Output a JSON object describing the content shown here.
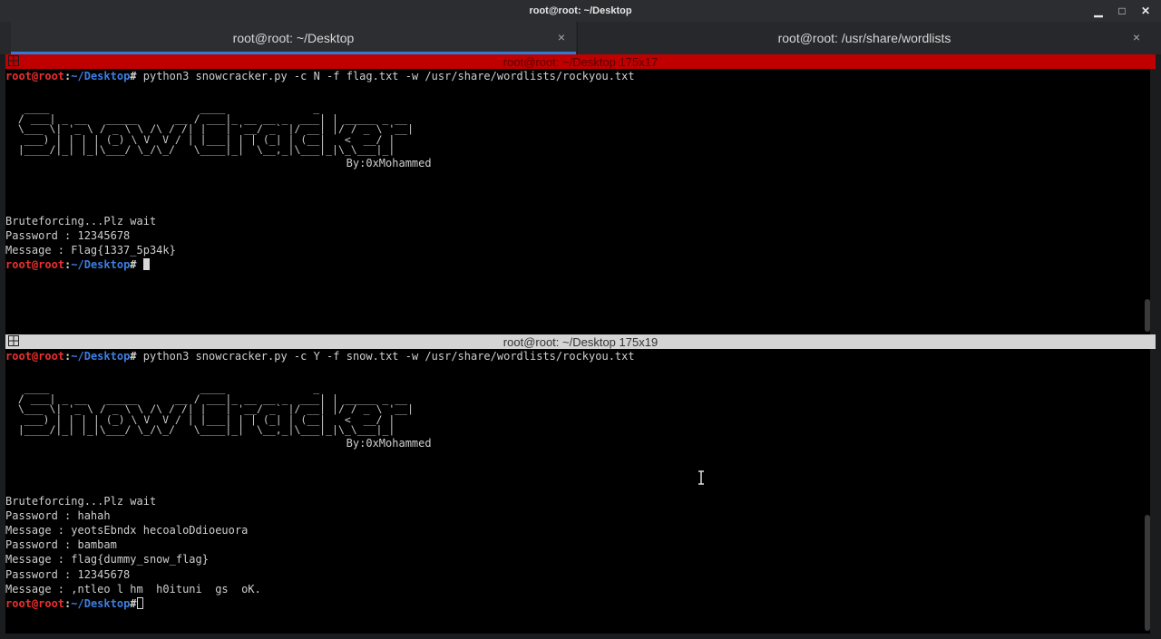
{
  "window": {
    "title": "root@root: ~/Desktop"
  },
  "window_controls": {
    "minimize": "▁",
    "maximize": "□",
    "close": "✕"
  },
  "tabs": [
    {
      "label": "root@root: ~/Desktop",
      "close": "×",
      "active": true
    },
    {
      "label": "root@root: /usr/share/wordlists",
      "close": "×",
      "active": false
    }
  ],
  "colors": {
    "accent": "#2f7bd8",
    "active_pane_header": "#c00000",
    "prompt_user": "#ee2f2f",
    "prompt_path": "#3d7fe0"
  },
  "prompt": {
    "user": "root@root",
    "sep": ":",
    "path": "~/Desktop",
    "symbol": "#"
  },
  "pane_top": {
    "header": "root@root: ~/Desktop 175x17",
    "command": " python3 snowcracker.py -c N -f flag.txt -w /usr/share/wordlists/rockyou.txt",
    "banner": "   ____                        ____              _\n  / ___| _ __   _____      __ / ___|_ __ __ _  ___| | _____ _ __\n  \\___ \\| '_ \\ / _ \\ \\ /\\ / /| |   | '__/ _` |/ __| |/ / _ \\ '__|\n   ___) | | | | (_) \\ V  V / | |___| | | (_| | (__|   <  __/ |\n  |____/|_| |_|\\___/ \\_/\\_/   \\____|_|  \\__,_|\\___|_|\\_\\___|_|",
    "author": "                                                    By:0xMohammed",
    "output": [
      "Bruteforcing...Plz wait",
      "Password : 12345678",
      "Message : Flag{1337_5p34k}"
    ]
  },
  "pane_bottom": {
    "header": "root@root: ~/Desktop 175x19",
    "command": " python3 snowcracker.py -c Y -f snow.txt -w /usr/share/wordlists/rockyou.txt",
    "banner": "   ____                        ____              _\n  / ___| _ __   _____      __ / ___|_ __ __ _  ___| | _____ _ __\n  \\___ \\| '_ \\ / _ \\ \\ /\\ / /| |   | '__/ _` |/ __| |/ / _ \\ '__|\n   ___) | | | | (_) \\ V  V / | |___| | | (_| | (__|   <  __/ |\n  |____/|_| |_|\\___/ \\_/\\_/   \\____|_|  \\__,_|\\___|_|\\_\\___|_|",
    "author": "                                                    By:0xMohammed",
    "output": [
      "Bruteforcing...Plz wait",
      "Password : hahah",
      "Message : yeotsEbndx hecoaloDdioeuora",
      "Password : bambam",
      "Message : flag{dummy_snow_flag}",
      "Password : 12345678",
      "Message : ,ntleo l hm  h0ituni  gs  oK."
    ]
  }
}
